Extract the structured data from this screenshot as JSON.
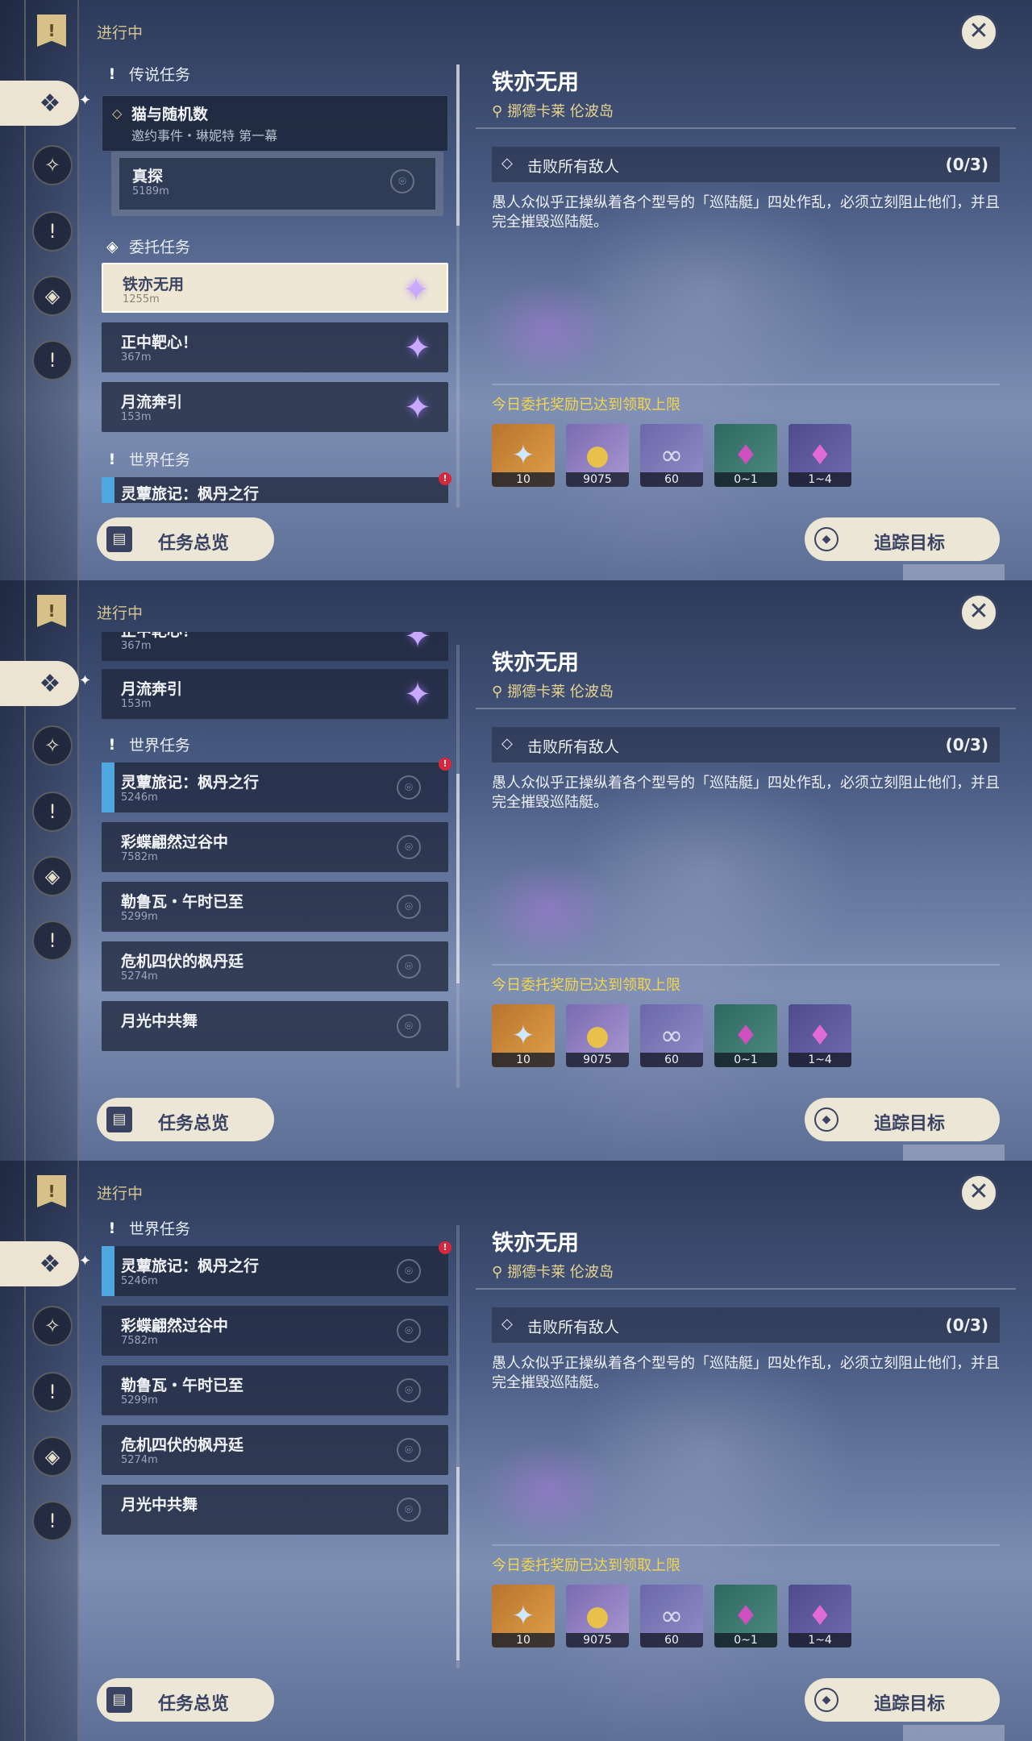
{
  "common": {
    "in_progress": "进行中",
    "overview_label": "任务总览",
    "track_label": "追踪目标",
    "close_symbol": "✕",
    "flag_symbol": "!",
    "detail": {
      "title": "铁亦无用",
      "location": "挪德卡莱 伦波岛",
      "objective": "击败所有敌人",
      "objective_count": "(0/3)",
      "description": "愚人众似乎正操纵着各个型号的「巡陆艇」四处作乱，必须立刻阻止他们，并且完全摧毁巡陆艇。",
      "reward_limit": "今日委托奖励已达到领取上限",
      "rewards": [
        {
          "icon": "primogem-icon",
          "count": "10"
        },
        {
          "icon": "mora-icon",
          "count": "9075"
        },
        {
          "icon": "companionship-exp-icon",
          "count": "60"
        },
        {
          "icon": "crystal-green-icon",
          "count": "0~1"
        },
        {
          "icon": "crystal-purple-icon",
          "count": "1~4"
        }
      ]
    },
    "colors": {
      "accent_gold": "#d9c690",
      "limit_yellow": "#f2d64e",
      "selected_card": "#efe7d4",
      "world_quest_bar": "#4fa7e0",
      "alert_red": "#d8263a"
    }
  },
  "panel1": {
    "sections": {
      "legend": "传说任务",
      "commission": "委托任务",
      "world": "世界任务"
    },
    "legend_parent": {
      "title": "猫与随机数",
      "subtitle": "邀约事件・琳妮特 第一幕"
    },
    "legend_child": {
      "title": "真探",
      "distance": "5189m"
    },
    "commissions": [
      {
        "title": "铁亦无用",
        "distance": "1255m",
        "selected": true
      },
      {
        "title": "正中靶心！",
        "distance": "367m"
      },
      {
        "title": "月流奔引",
        "distance": "153m"
      }
    ],
    "world_partial": {
      "title": "灵蕈旅记：枫丹之行"
    }
  },
  "panel2": {
    "commissions": [
      {
        "title": "正中靶心！",
        "distance": "367m"
      },
      {
        "title": "月流奔引",
        "distance": "153m"
      }
    ],
    "world_head": "世界任务",
    "world": [
      {
        "title": "灵蕈旅记：枫丹之行",
        "distance": "5246m"
      },
      {
        "title": "彩蝶翩然过谷中",
        "distance": "7582m"
      },
      {
        "title": "勒鲁瓦・午时已至",
        "distance": "5299m"
      },
      {
        "title": "危机四伏的枫丹廷",
        "distance": "5274m"
      },
      {
        "title": "月光中共舞",
        "distance": ""
      }
    ]
  },
  "panel3": {
    "world_head": "世界任务",
    "world": [
      {
        "title": "灵蕈旅记：枫丹之行",
        "distance": "5246m"
      },
      {
        "title": "彩蝶翩然过谷中",
        "distance": "7582m"
      },
      {
        "title": "勒鲁瓦・午时已至",
        "distance": "5299m"
      },
      {
        "title": "危机四伏的枫丹廷",
        "distance": "5274m"
      },
      {
        "title": "月光中共舞",
        "distance": ""
      }
    ]
  }
}
